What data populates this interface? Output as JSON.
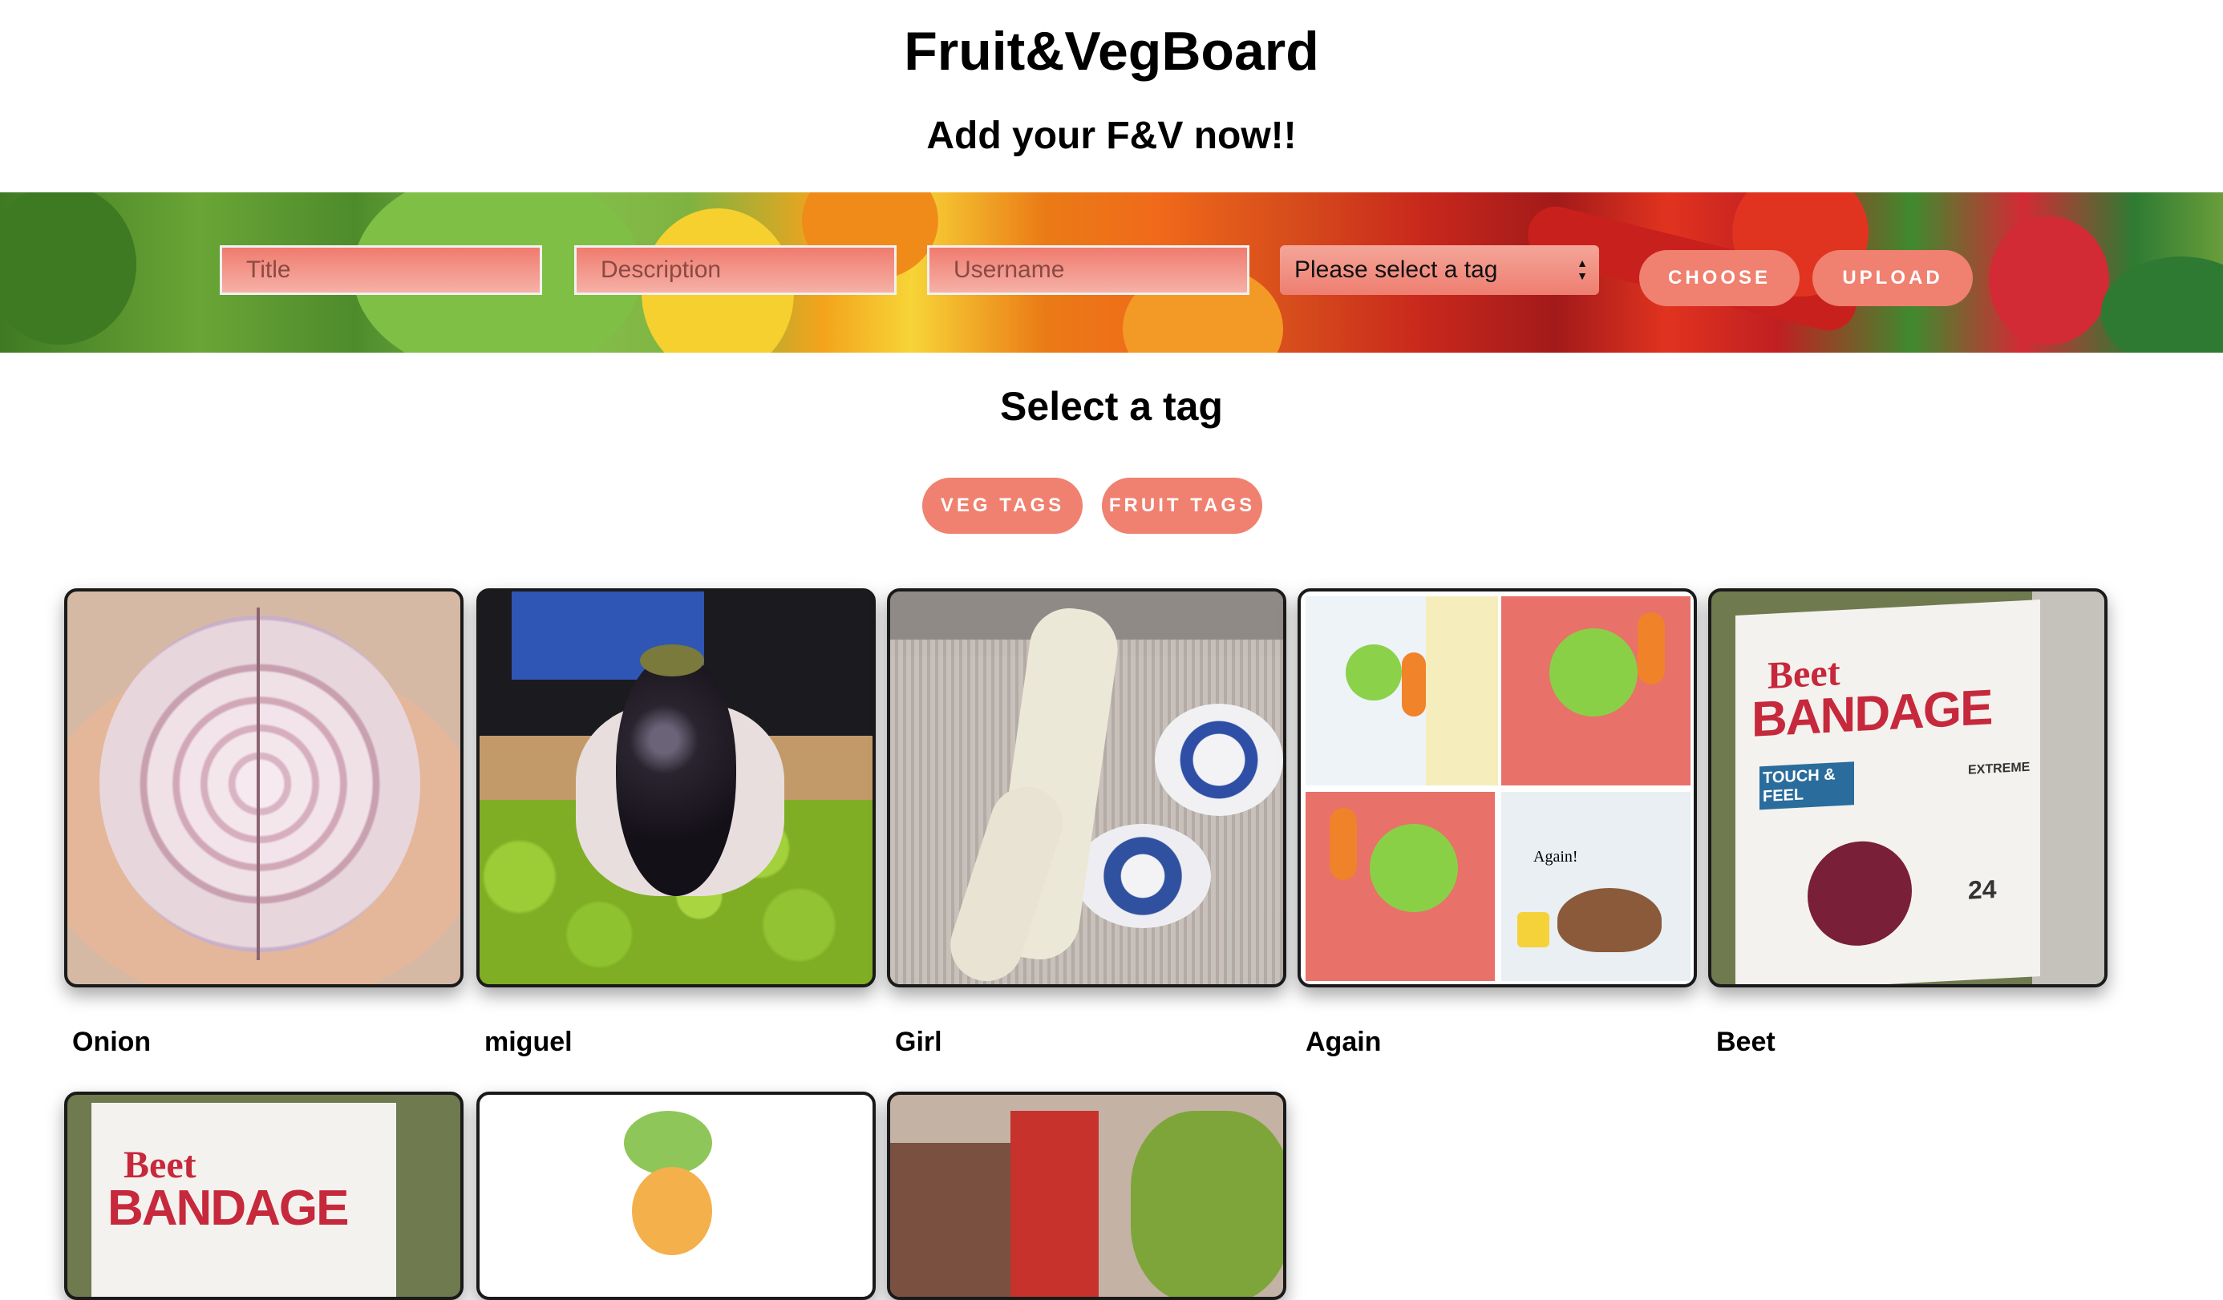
{
  "header": {
    "title": "Fruit&VegBoard",
    "subtitle": "Add your F&V now!!"
  },
  "form": {
    "title_placeholder": "Title",
    "description_placeholder": "Description",
    "username_placeholder": "Username",
    "tag_select_value": "Please select a tag",
    "choose_label": "CHOOSE",
    "upload_label": "UPLOAD"
  },
  "tags": {
    "heading": "Select a tag",
    "veg_label": "VEG TAGS",
    "fruit_label": "FRUIT TAGS"
  },
  "posts": [
    {
      "title": "Onion"
    },
    {
      "title": "miguel"
    },
    {
      "title": "Girl"
    },
    {
      "title": "Again"
    },
    {
      "title": "Beet"
    },
    {
      "title": ""
    },
    {
      "title": ""
    },
    {
      "title": ""
    }
  ],
  "image_text": {
    "beet_word": "Beet",
    "bandage_word": "BANDAGE",
    "touch_feel": "TOUCH & FEEL",
    "extreme": "EXTREME",
    "count": "24",
    "again_caption": "Again!"
  },
  "colors": {
    "accent": "#f0806f",
    "input_fill": "#f4a699"
  }
}
